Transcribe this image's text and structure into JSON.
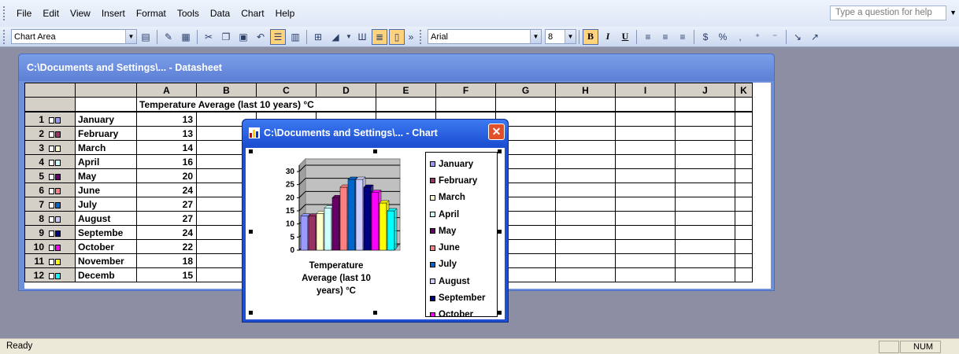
{
  "menu": [
    "File",
    "Edit",
    "View",
    "Insert",
    "Format",
    "Tools",
    "Data",
    "Chart",
    "Help"
  ],
  "help_box": {
    "placeholder": "Type a question for help"
  },
  "toolbar": {
    "chart_area": "Chart Area",
    "font_name": "Arial",
    "font_size": "8",
    "bold": "B",
    "italic": "I",
    "underline": "U"
  },
  "datasheet": {
    "title": "C:\\Documents and Settings\\... - Datasheet",
    "columns": [
      "A",
      "B",
      "C",
      "D",
      "E",
      "F",
      "G",
      "H",
      "I",
      "J",
      "K"
    ],
    "header_label": "Temperature Average (last 10 years) °C",
    "rows": [
      {
        "num": "1",
        "label": "January",
        "value": "13"
      },
      {
        "num": "2",
        "label": "February",
        "value": "13"
      },
      {
        "num": "3",
        "label": "March",
        "value": "14"
      },
      {
        "num": "4",
        "label": "April",
        "value": "16"
      },
      {
        "num": "5",
        "label": "May",
        "value": "20"
      },
      {
        "num": "6",
        "label": "June",
        "value": "24"
      },
      {
        "num": "7",
        "label": "July",
        "value": "27"
      },
      {
        "num": "8",
        "label": "August",
        "value": "27"
      },
      {
        "num": "9",
        "label": "Septembe",
        "value": "24"
      },
      {
        "num": "10",
        "label": "October",
        "value": "22"
      },
      {
        "num": "11",
        "label": "November",
        "value": "18"
      },
      {
        "num": "12",
        "label": "Decemb",
        "value": "15"
      }
    ]
  },
  "chart_window": {
    "title": "C:\\Documents and Settings\\... - Chart"
  },
  "chart_data": {
    "type": "bar",
    "categories": [
      "Temperature Average (last 10 years) °C"
    ],
    "series": [
      {
        "name": "January",
        "values": [
          13
        ]
      },
      {
        "name": "February",
        "values": [
          13
        ]
      },
      {
        "name": "March",
        "values": [
          14
        ]
      },
      {
        "name": "April",
        "values": [
          16
        ]
      },
      {
        "name": "May",
        "values": [
          20
        ]
      },
      {
        "name": "June",
        "values": [
          24
        ]
      },
      {
        "name": "July",
        "values": [
          27
        ]
      },
      {
        "name": "August",
        "values": [
          27
        ]
      },
      {
        "name": "September",
        "values": [
          24
        ]
      },
      {
        "name": "October",
        "values": [
          22
        ]
      },
      {
        "name": "November",
        "values": [
          18
        ]
      },
      {
        "name": "December",
        "values": [
          15
        ]
      }
    ],
    "yticks": [
      "30",
      "25",
      "20",
      "15",
      "10",
      "5",
      "0"
    ],
    "ylim": [
      0,
      30
    ],
    "xlabel": "Temperature Average (last 10 years) °C",
    "legend_visible": [
      "January",
      "February",
      "March",
      "April",
      "May",
      "June",
      "July",
      "August",
      "September",
      "October"
    ],
    "legend_position": "right",
    "grid": true
  },
  "colors": {
    "series": [
      "#9999ff",
      "#993366",
      "#ffffcc",
      "#ccffff",
      "#660066",
      "#ff8080",
      "#0066cc",
      "#ccccff",
      "#000080",
      "#ff00ff",
      "#ffff00",
      "#00ffff"
    ],
    "plot_bg": "#c0c0c0"
  },
  "status": {
    "ready": "Ready",
    "num": "NUM"
  }
}
